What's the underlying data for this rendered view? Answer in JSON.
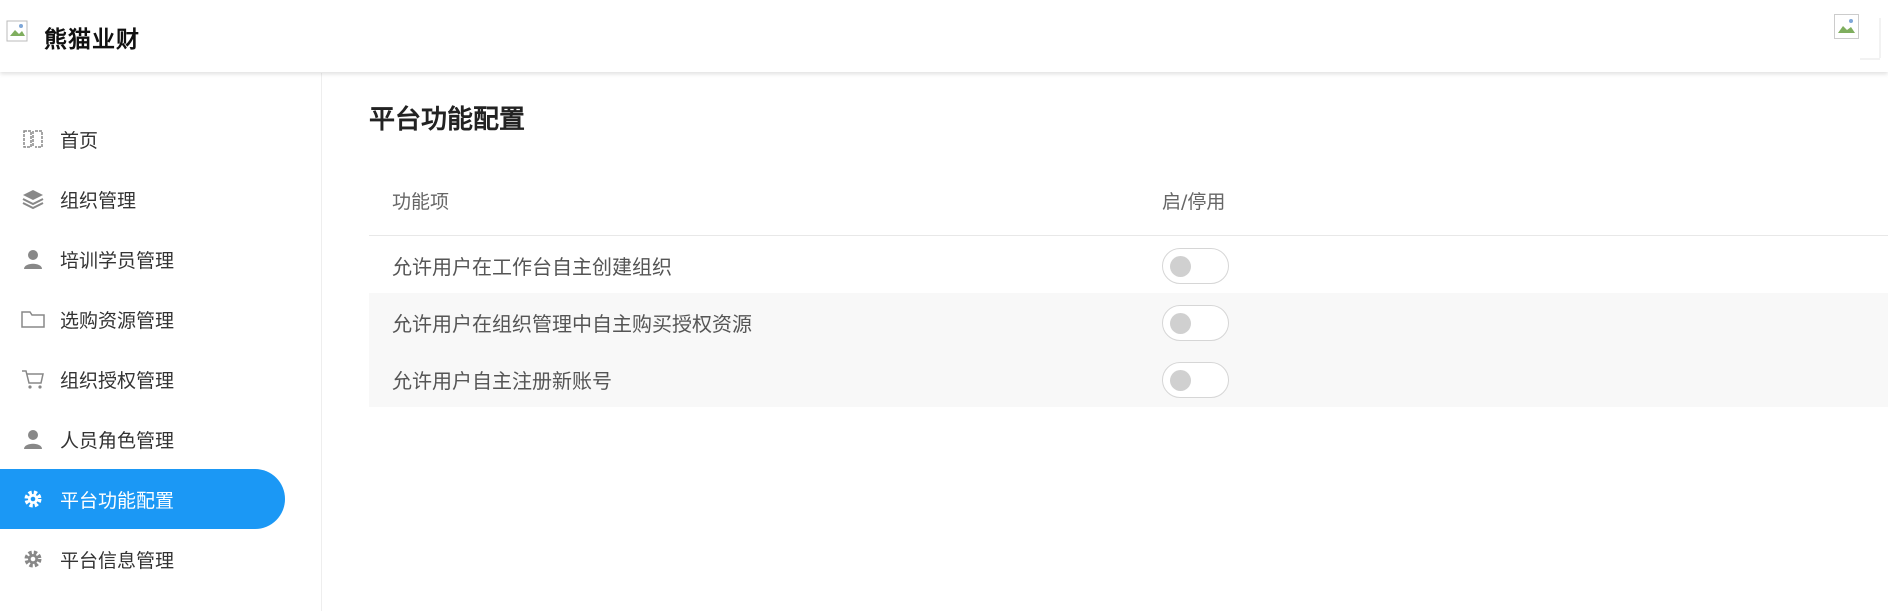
{
  "header": {
    "brand": "熊猫业财",
    "logo_icon": "broken-image-icon",
    "avatar_icon": "broken-image-icon"
  },
  "sidebar": {
    "items": [
      {
        "label": "首页",
        "icon": "book-icon",
        "active": false
      },
      {
        "label": "组织管理",
        "icon": "layers-icon",
        "active": false
      },
      {
        "label": "培训学员管理",
        "icon": "user-icon",
        "active": false
      },
      {
        "label": "选购资源管理",
        "icon": "folder-icon",
        "active": false
      },
      {
        "label": "组织授权管理",
        "icon": "cart-icon",
        "active": false
      },
      {
        "label": "人员角色管理",
        "icon": "user-icon",
        "active": false
      },
      {
        "label": "平台功能配置",
        "icon": "gear-icon",
        "active": true
      },
      {
        "label": "平台信息管理",
        "icon": "gear-icon",
        "active": false
      }
    ],
    "active_color": "#1b98f5"
  },
  "main": {
    "title": "平台功能配置",
    "table": {
      "headers": [
        "功能项",
        "启/停用"
      ],
      "rows": [
        {
          "label": "允许用户在工作台自主创建组织",
          "enabled": false
        },
        {
          "label": "允许用户在组织管理中自主购买授权资源",
          "enabled": false
        },
        {
          "label": "允许用户自主注册新账号",
          "enabled": false
        }
      ]
    }
  }
}
